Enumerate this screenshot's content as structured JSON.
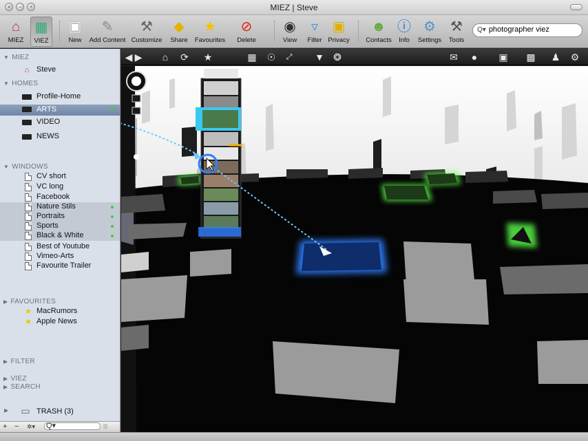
{
  "window": {
    "title": "MIEZ | Steve"
  },
  "toolbar": {
    "miez": "MIEZ",
    "viez": "VIEZ",
    "new": "New",
    "add_content": "Add Content",
    "customize": "Customize",
    "share": "Share",
    "favourites": "Favourites",
    "delete": "Delete",
    "view": "View",
    "filter": "Filter",
    "privacy": "Privacy",
    "contacts": "Contacts",
    "info": "Info",
    "settings": "Settings",
    "tools": "Tools",
    "search_value": "photographer viez"
  },
  "sidebar": {
    "miez": {
      "label": "MIEZ",
      "items": [
        "Steve"
      ]
    },
    "homes": {
      "label": "HOMES",
      "items": [
        "Profile-Home",
        "ARTS",
        "VIDEO",
        "NEWS"
      ]
    },
    "windows": {
      "label": "WINDOWS",
      "items": [
        "CV short",
        "VC long",
        "Facebook",
        "Nature Stils",
        "Portraits",
        "Sports",
        "Black & White",
        "Best of Youtube",
        "Vimeo-Arts",
        "Favourite Trailer"
      ]
    },
    "favourites": {
      "label": "FAVOURITES",
      "items": [
        "MacRumors",
        "Apple News"
      ]
    },
    "filter": "FILTER",
    "viez": "VIEZ",
    "search": "SEARCH",
    "trash": "TRASH (3)"
  },
  "footer": {
    "add": "+",
    "remove": "−",
    "gear": "✲▾",
    "search_glyph": "Q▾",
    "resize": "|||"
  },
  "colors": {
    "accent_blue": "#2f7fff",
    "green_glow": "#5cff4a",
    "selection": "#6f86a6"
  }
}
